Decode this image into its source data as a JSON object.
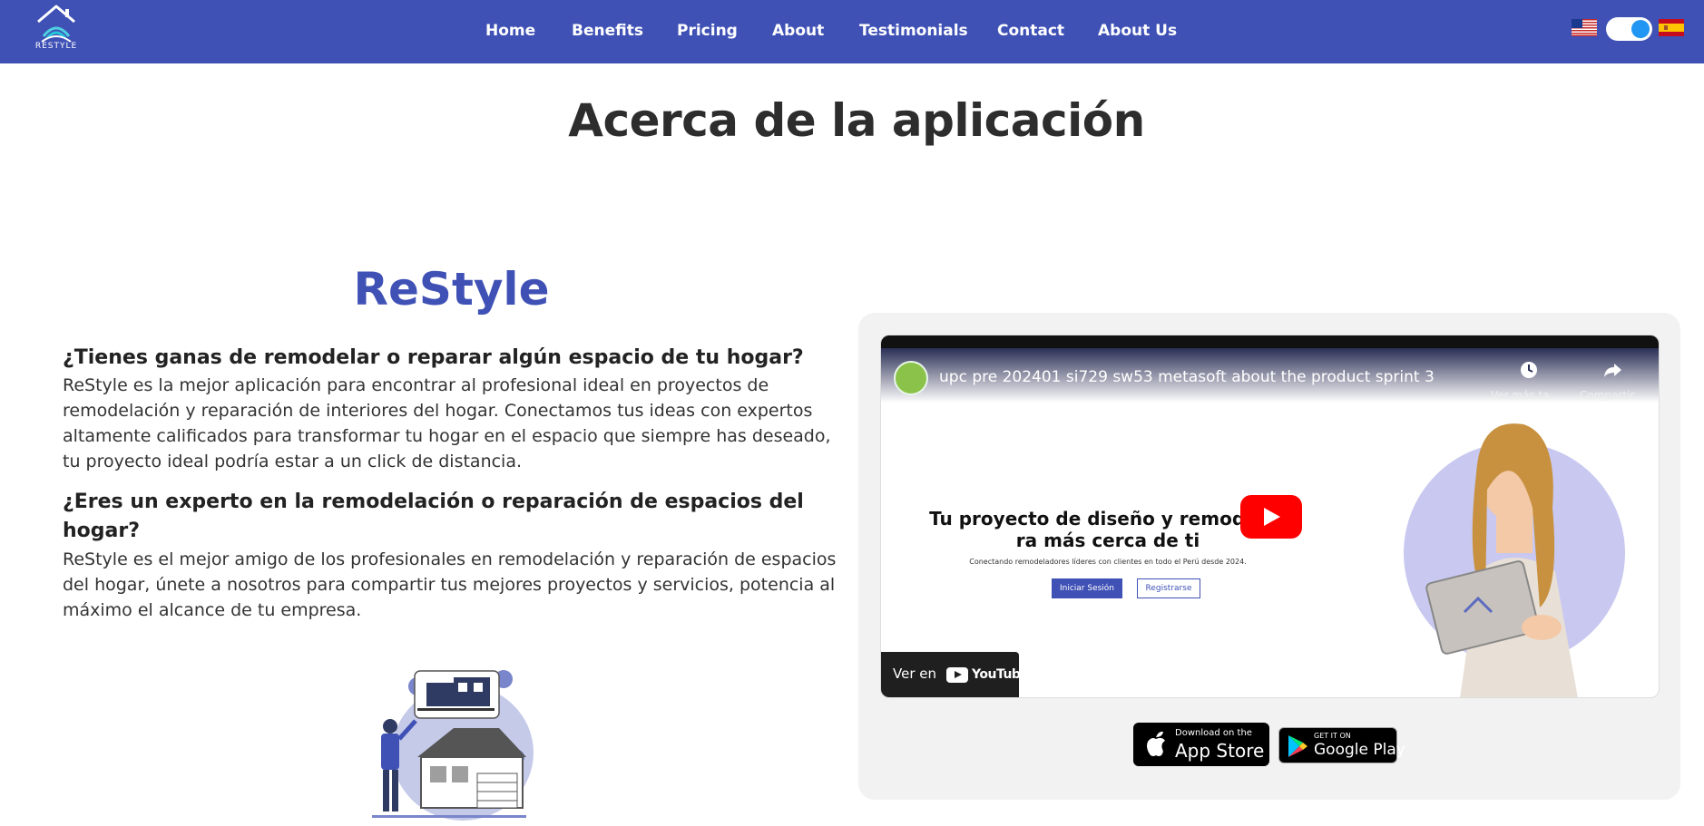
{
  "nav": {
    "logo_text": "RESTYLE",
    "links": [
      "Home",
      "Benefits",
      "Pricing",
      "About",
      "Testimonials",
      "Contact",
      "About Us"
    ]
  },
  "page_title": "Acerca de la aplicación",
  "about": {
    "brand": "ReStyle",
    "q1": "¿Tienes ganas de remodelar o reparar algún espacio de tu hogar?",
    "p1": "ReStyle es la mejor aplicación para encontrar al profesional ideal en proyectos de remodelación y reparación de interiores del hogar. Conectamos tus ideas con expertos altamente calificados para transformar tu hogar en el espacio que siempre has deseado, tu proyecto ideal podría estar a un click de distancia.",
    "q2": "¿Eres un experto en la remodelación o reparación de espacios del hogar?",
    "p2": "ReStyle es el mejor amigo de los profesionales en remodelación y reparación de espacios del hogar, únete a nosotros para compartir tus mejores proyectos y servicios, potencia al máximo el alcance de tu empresa."
  },
  "video": {
    "title": "upc pre 202401 si729 sw53 metasoft about the product sprint 3",
    "watch_later": "Ver más ta...",
    "share": "Compartir",
    "promo_heading": "Tu proyecto de diseño y remodelac   ra más cerca de ti",
    "promo_sub": "Conectando remodeladores líderes con clientes en todo el Perú desde 2024.",
    "login": "Iniciar Sesión",
    "register": "Registrarse",
    "watch_on": "Ver en",
    "youtube": "YouTube"
  },
  "stores": {
    "apple_small": "Download on the",
    "apple_big": "App Store",
    "google_small": "GET IT ON",
    "google_big": "Google Play"
  },
  "colors": {
    "primary": "#3f51b5",
    "toggle_knob": "#2196f3",
    "card_bg": "#f2f2f2"
  }
}
